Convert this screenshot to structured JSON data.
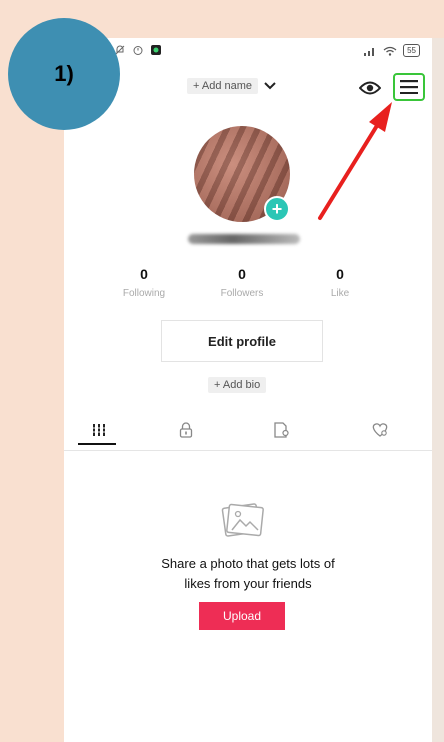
{
  "step_badge": "1)",
  "status_bar": {
    "battery": "55"
  },
  "header": {
    "add_name": "+ Add name"
  },
  "stats": [
    {
      "value": "0",
      "label": "Following"
    },
    {
      "value": "0",
      "label": "Followers"
    },
    {
      "value": "0",
      "label": "Like"
    }
  ],
  "edit_profile_label": "Edit profile",
  "add_bio_label": "+ Add bio",
  "tabs": [
    {
      "icon": "grid-icon"
    },
    {
      "icon": "lock-icon"
    },
    {
      "icon": "tagged-icon"
    },
    {
      "icon": "liked-heart-icon"
    }
  ],
  "empty_state": {
    "line1": "Share a photo that gets lots of",
    "line2": "likes from your friends",
    "button": "Upload"
  },
  "colors": {
    "background": "#f9e0d0",
    "badge": "#3e8fb2",
    "highlight": "#39c539",
    "arrow": "#e8201e",
    "upload": "#ee2d55",
    "avatar_plus": "#2bc6b5"
  }
}
